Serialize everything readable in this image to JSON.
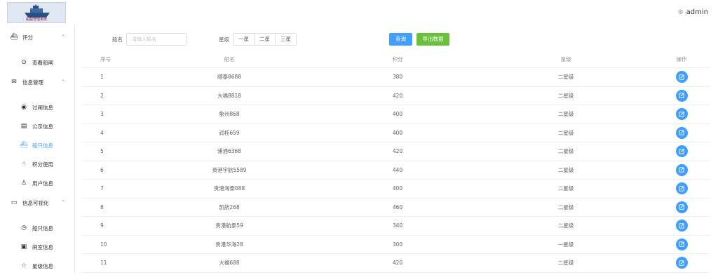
{
  "header": {
    "logo_text": "船舶管理系统",
    "user_name": "admin",
    "user_icon": "gear-icon"
  },
  "sidebar": {
    "items": [
      {
        "label": "评分",
        "icon": "ship-icon",
        "type": "group",
        "arrow": "^"
      },
      {
        "label": "查看船闸",
        "icon": "check-circle-icon",
        "type": "sub"
      },
      {
        "label": "信息管理",
        "icon": "mail-icon",
        "type": "group",
        "arrow": "^"
      },
      {
        "label": "过闸信息",
        "icon": "eye-icon",
        "type": "sub"
      },
      {
        "label": "公示信息",
        "icon": "document-icon",
        "type": "sub"
      },
      {
        "label": "船只信息",
        "icon": "ship-icon",
        "type": "sub",
        "active": true
      },
      {
        "label": "积分使用",
        "icon": "hand-pointer-icon",
        "type": "sub"
      },
      {
        "label": "用户信息",
        "icon": "user-icon",
        "type": "sub"
      },
      {
        "label": "信息可视化",
        "icon": "monitor-icon",
        "type": "group",
        "arrow": "^"
      },
      {
        "label": "船只信息",
        "icon": "clock-icon",
        "type": "sub"
      },
      {
        "label": "闸室信息",
        "icon": "file-icon",
        "type": "sub"
      },
      {
        "label": "星级信息",
        "icon": "star-icon",
        "type": "sub"
      }
    ],
    "active_color": "#409eff"
  },
  "filter": {
    "ship_name_label": "船名",
    "ship_name_placeholder": "请输入船名",
    "star_label": "星级",
    "star_options": [
      "一星",
      "二星",
      "三星"
    ],
    "query_button": "查询",
    "export_button": "导出数据",
    "query_color": "#409eff",
    "export_color": "#67c23a"
  },
  "table": {
    "columns": [
      "序号",
      "船名",
      "积分",
      "星级",
      "操作"
    ],
    "rows": [
      {
        "index": "1",
        "name": "顺泰8688",
        "score": "380",
        "star": "二星级"
      },
      {
        "index": "2",
        "name": "大福8818",
        "score": "420",
        "star": "二星级"
      },
      {
        "index": "3",
        "name": "象州868",
        "score": "400",
        "star": "二星级"
      },
      {
        "index": "4",
        "name": "润桂659",
        "score": "400",
        "star": "二星级"
      },
      {
        "index": "5",
        "name": "浦通6368",
        "score": "420",
        "star": "二星级"
      },
      {
        "index": "6",
        "name": "贵港宇航5589",
        "score": "440",
        "star": "二星级"
      },
      {
        "index": "7",
        "name": "贵港海泰088",
        "score": "400",
        "star": "二星级"
      },
      {
        "index": "8",
        "name": "凯航268",
        "score": "460",
        "star": "二星级"
      },
      {
        "index": "9",
        "name": "贵港航泰59",
        "score": "340",
        "star": "二星级"
      },
      {
        "index": "10",
        "name": "贵港华海28",
        "score": "300",
        "star": "一星级"
      },
      {
        "index": "11",
        "name": "大福688",
        "score": "420",
        "star": "二星级"
      }
    ],
    "edit_icon": "edit-icon"
  }
}
